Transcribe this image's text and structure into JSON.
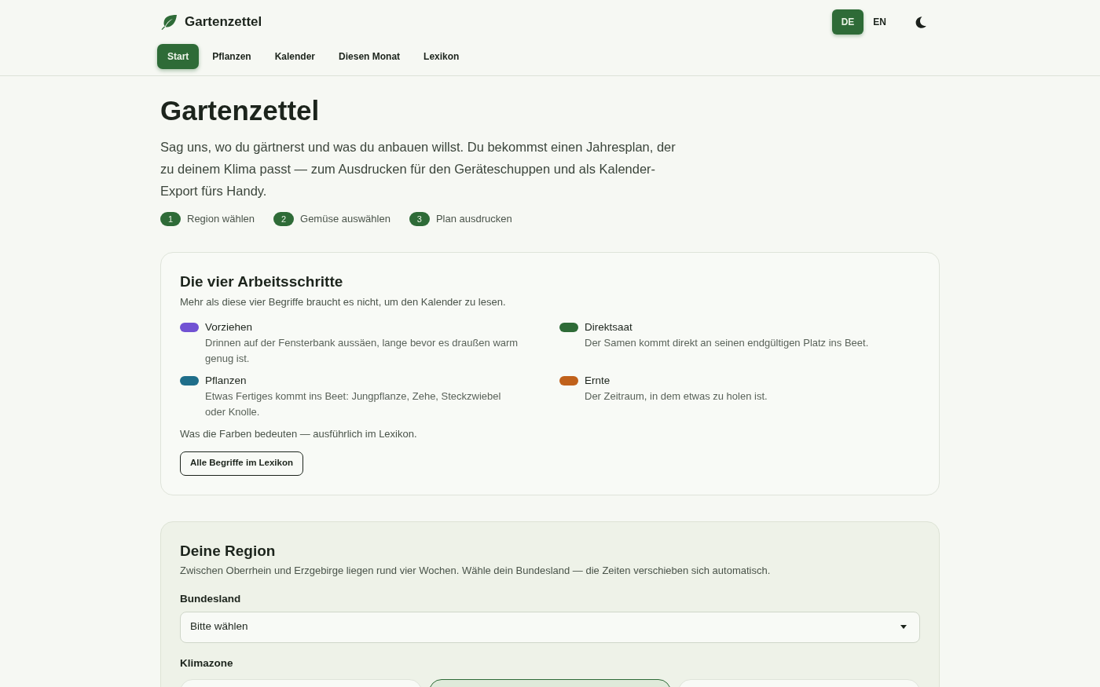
{
  "header": {
    "brand": "Gartenzettel",
    "languages": [
      {
        "label": "DE",
        "selected": true
      },
      {
        "label": "EN",
        "selected": false
      }
    ]
  },
  "nav": {
    "items": [
      {
        "label": "Start",
        "selected": true
      },
      {
        "label": "Pflanzen",
        "selected": false
      },
      {
        "label": "Kalender",
        "selected": false
      },
      {
        "label": "Diesen Monat",
        "selected": false
      },
      {
        "label": "Lexikon",
        "selected": false
      }
    ]
  },
  "hero": {
    "title": "Gartenzettel",
    "intro": "Sag uns, wo du gärtnerst und was du anbauen willst. Du bekommst einen Jahresplan, der zu deinem Klima passt — zum Ausdrucken für den Geräteschuppen und als Kalender-Export fürs Handy.",
    "steps": [
      {
        "number": "1",
        "label": "Region wählen"
      },
      {
        "number": "2",
        "label": "Gemüse auswählen"
      },
      {
        "number": "3",
        "label": "Plan ausdrucken"
      }
    ]
  },
  "legend": {
    "title": "Die vier Arbeitsschritte",
    "subtitle": "Mehr als diese vier Begriffe braucht es nicht, um den Kalender zu lesen.",
    "items": [
      {
        "label": "Vorziehen",
        "description": "Drinnen auf der Fensterbank aussäen, lange bevor es draußen warm genug ist.",
        "color": "#7152d3"
      },
      {
        "label": "Direktsaat",
        "description": "Der Samen kommt direkt an seinen endgültigen Platz ins Beet.",
        "color": "#2e6b37"
      },
      {
        "label": "Pflanzen",
        "description": "Etwas Fertiges kommt ins Beet: Jungpflanze, Zehe, Steckzwiebel oder Knolle.",
        "color": "#1f6e8a"
      },
      {
        "label": "Ernte",
        "description": "Der Zeitraum, in dem etwas zu holen ist.",
        "color": "#c0611b"
      }
    ],
    "note": "Was die Farben bedeuten — ausführlich im Lexikon.",
    "button": "Alle Begriffe im Lexikon"
  },
  "region": {
    "title": "Deine Region",
    "subtitle": "Zwischen Oberrhein und Erzgebirge liegen rund vier Wochen. Wähle dein Bundesland — die Zeiten verschieben sich automatisch.",
    "state_field": {
      "label": "Bundesland",
      "value": "Bitte wählen"
    },
    "climate_zone": {
      "label": "Klimazone",
      "options": [
        {
          "selected": false
        },
        {
          "selected": true
        },
        {
          "selected": false
        }
      ]
    }
  }
}
